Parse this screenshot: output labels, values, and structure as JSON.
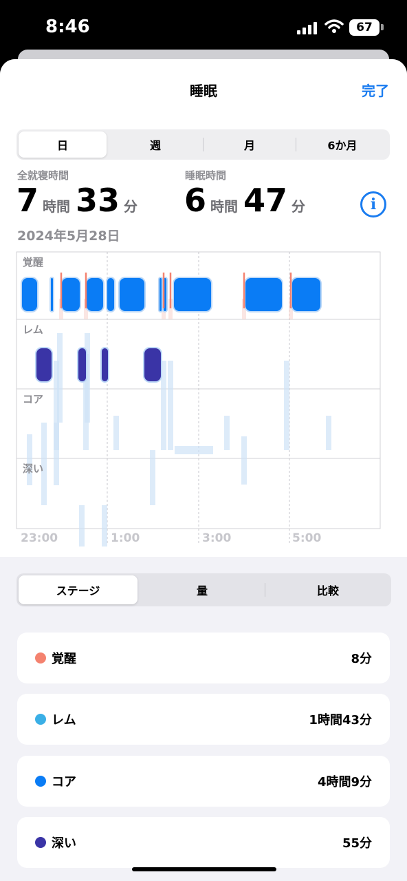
{
  "status": {
    "time": "8:46",
    "battery": "67"
  },
  "header": {
    "title": "睡眠",
    "done": "完了"
  },
  "range_tabs": [
    {
      "label": "日",
      "active": true
    },
    {
      "label": "週",
      "active": false
    },
    {
      "label": "月",
      "active": false
    },
    {
      "label": "6か月",
      "active": false
    }
  ],
  "stats": {
    "in_bed": {
      "label": "全就寝時間",
      "hours": "7",
      "hours_unit": "時間",
      "minutes": "33",
      "minutes_unit": "分"
    },
    "asleep": {
      "label": "睡眠時間",
      "hours": "6",
      "hours_unit": "時間",
      "minutes": "47",
      "minutes_unit": "分"
    },
    "date": "2024年5月28日",
    "info_icon": "info-circle-icon"
  },
  "chart_data": {
    "type": "sleep-stages",
    "stages": [
      "覚醒",
      "レム",
      "コア",
      "深い"
    ],
    "x_ticks": [
      "23:00",
      "1:00",
      "3:00",
      "5:00"
    ],
    "colors": {
      "awake": "#f4826f",
      "rem": "#3aafe6",
      "core": "#0a7cf5",
      "deep": "#3a34a6"
    }
  },
  "view_tabs": [
    {
      "label": "ステージ",
      "active": true
    },
    {
      "label": "量",
      "active": false
    },
    {
      "label": "比較",
      "active": false
    }
  ],
  "summary": [
    {
      "label": "覚醒",
      "value": "8分",
      "color": "#f4826f"
    },
    {
      "label": "レム",
      "value": "1時間43分",
      "color": "#3aafe6"
    },
    {
      "label": "コア",
      "value": "4時間9分",
      "color": "#0a7cf5"
    },
    {
      "label": "深い",
      "value": "55分",
      "color": "#3a34a6"
    }
  ]
}
